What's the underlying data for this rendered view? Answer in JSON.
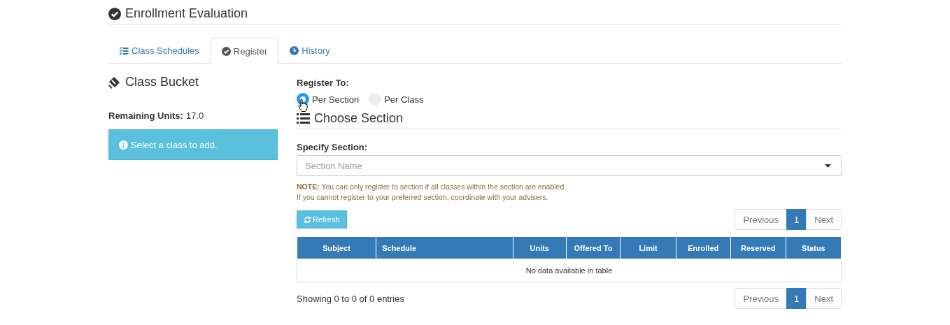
{
  "page_title": "Enrollment Evaluation",
  "tabs": [
    {
      "label": "Class Schedules",
      "kind": "list",
      "selected": false
    },
    {
      "label": "Register",
      "kind": "check",
      "selected": true
    },
    {
      "label": "History",
      "kind": "clock",
      "selected": false
    }
  ],
  "class_bucket": {
    "title": "Class Bucket",
    "remaining_label": "Remaining Units:",
    "remaining_value": "17.0",
    "alert": "Select a class to add."
  },
  "register_to": {
    "label": "Register To:",
    "options": [
      {
        "label": "Per Section",
        "selected": true
      },
      {
        "label": "Per Class",
        "selected": false
      }
    ]
  },
  "choose_section": {
    "title": "Choose Section",
    "field_label": "Specify Section:",
    "placeholder": "Section Name",
    "notes": [
      "**NOTE:** You can only register to section if all classes within the section are enabled.",
      "If you cannot register to your preferred section, coordinate with your advisers."
    ]
  },
  "refresh_button": "Refresh",
  "pagination_top": [
    {
      "label": "Previous",
      "selected": false,
      "disabled": true
    },
    {
      "label": "1",
      "selected": true,
      "disabled": false
    },
    {
      "label": "Next",
      "selected": false,
      "disabled": true
    }
  ],
  "table": {
    "columns": [
      "Subject",
      "Schedule",
      "Units",
      "Offered To",
      "Limit",
      "Enrolled",
      "Reserved",
      "Status"
    ],
    "empty_message": "No data available in table"
  },
  "info": "Showing 0 to 0 of 0 entries",
  "pagination_bottom": [
    {
      "label": "Previous",
      "selected": false,
      "disabled": true
    },
    {
      "label": "1",
      "selected": true,
      "disabled": false
    },
    {
      "label": "Next",
      "selected": false,
      "disabled": true
    }
  ]
}
